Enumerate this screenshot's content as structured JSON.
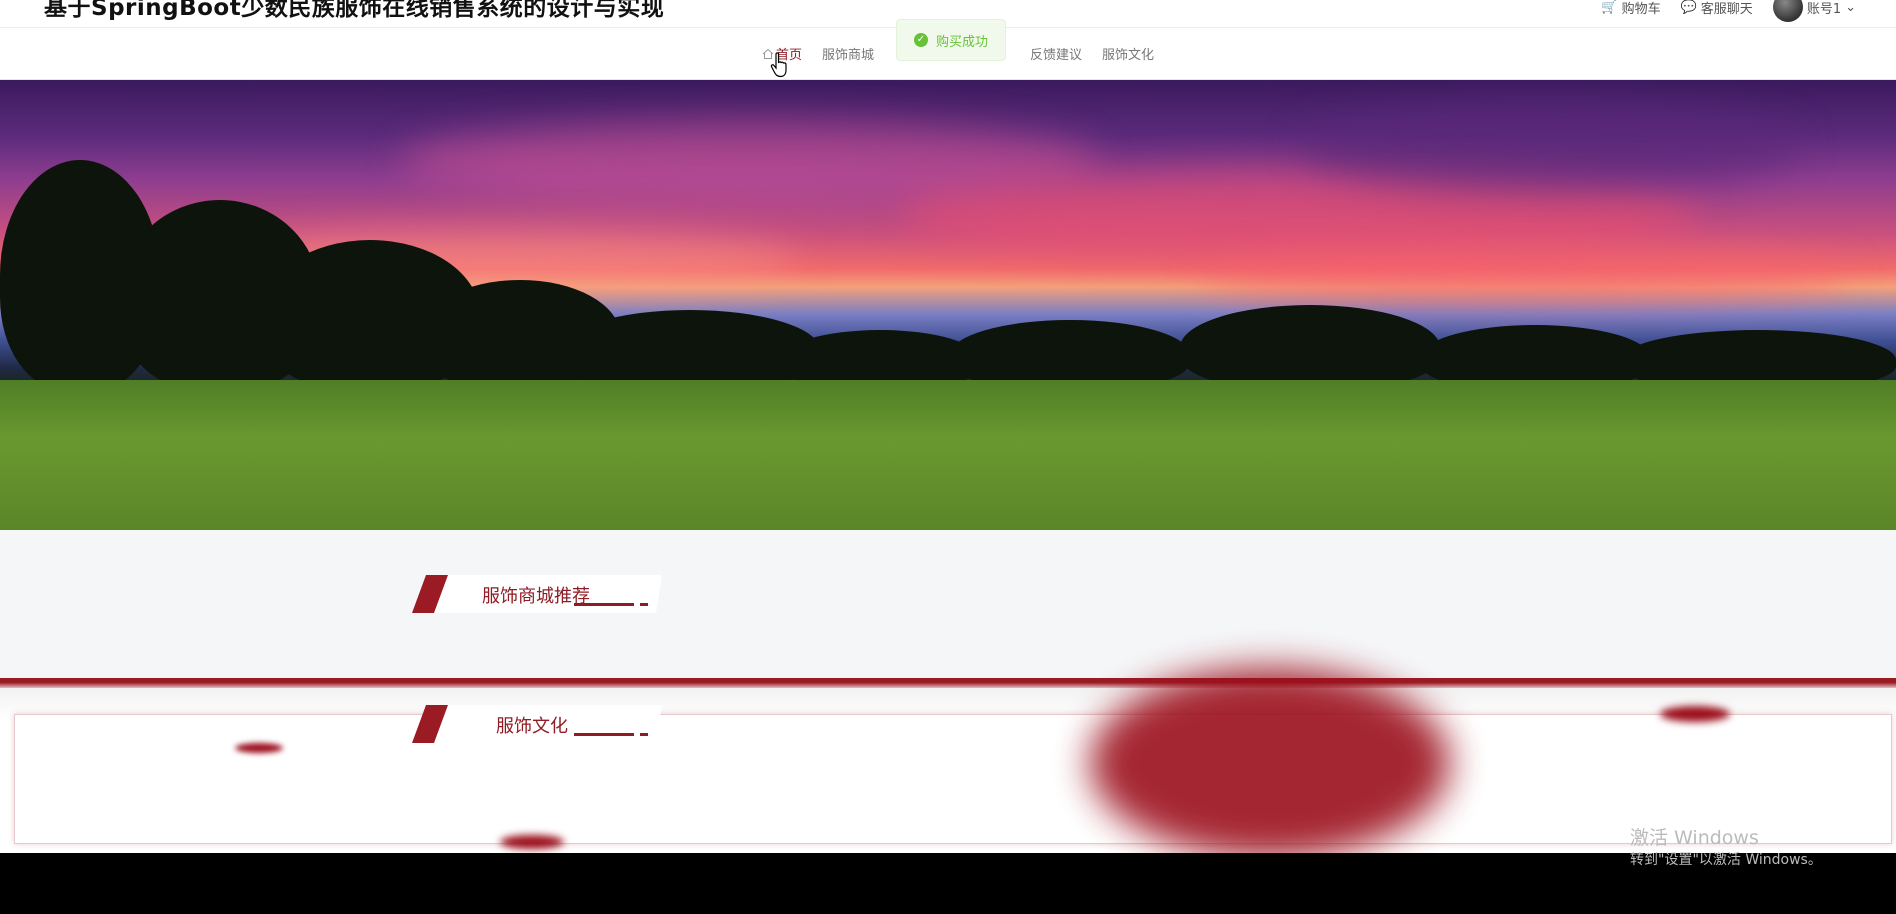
{
  "header": {
    "site_title": "基于SpringBoot少数民族服饰在线销售系统的设计与实现",
    "cart_label": "购物车",
    "service_label": "客服聊天",
    "account_label": "账号1"
  },
  "nav": {
    "items": [
      {
        "label": "首页",
        "active": true
      },
      {
        "label": "服饰商城",
        "active": false
      },
      {
        "label": "反馈建议",
        "active": false
      },
      {
        "label": "服饰文化",
        "active": false
      }
    ]
  },
  "toast": {
    "message": "购买成功",
    "type": "success",
    "color": "#67c23a"
  },
  "sections": [
    {
      "title": "服饰商城推荐"
    },
    {
      "title": "服饰文化"
    }
  ],
  "theme": {
    "accent": "#8f1c24",
    "dark_accent": "#9b0f1c"
  },
  "watermark": {
    "line1": "激活 Windows",
    "line2": "转到\"设置\"以激活 Windows。"
  }
}
